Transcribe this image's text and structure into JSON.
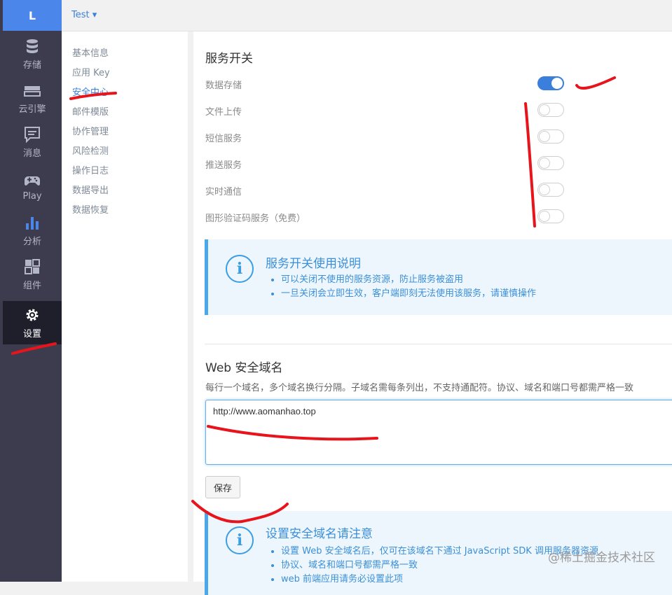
{
  "logo": "L",
  "topbar": {
    "app_name": "Test ▾"
  },
  "nav": [
    {
      "icon": "database-icon",
      "label": "存储"
    },
    {
      "icon": "cloud-engine-icon",
      "label": "云引擎"
    },
    {
      "icon": "message-icon",
      "label": "消息"
    },
    {
      "icon": "gamepad-icon",
      "label": "Play"
    },
    {
      "icon": "chart-icon",
      "label": "分析"
    },
    {
      "icon": "components-icon",
      "label": "组件"
    },
    {
      "icon": "gear-icon",
      "label": "设置",
      "active": true
    }
  ],
  "subnav": [
    "基本信息",
    "应用 Key",
    "安全中心",
    "邮件模版",
    "协作管理",
    "风险检测",
    "操作日志",
    "数据导出",
    "数据恢复"
  ],
  "subnav_active_index": 2,
  "services": {
    "title": "服务开关",
    "items": [
      {
        "label": "数据存储",
        "on": true
      },
      {
        "label": "文件上传",
        "on": false
      },
      {
        "label": "短信服务",
        "on": false
      },
      {
        "label": "推送服务",
        "on": false
      },
      {
        "label": "实时通信",
        "on": false
      },
      {
        "label": "图形验证码服务（免费）",
        "on": false
      }
    ]
  },
  "service_notice": {
    "title": "服务开关使用说明",
    "items": [
      "可以关闭不使用的服务资源，防止服务被盗用",
      "一旦关闭会立即生效，客户端即刻无法使用该服务，请谨慎操作"
    ]
  },
  "web_domain": {
    "title": "Web 安全域名",
    "hint": "每行一个域名，多个域名换行分隔。子域名需每条列出，不支持通配符。协议、域名和端口号都需严格一致",
    "value": "http://www.aomanhao.top",
    "save_label": "保存"
  },
  "domain_notice": {
    "title": "设置安全域名请注意",
    "items": [
      "设置 Web 安全域名后，仅可在该域名下通过 JavaScript SDK 调用服务器资源",
      "协议、域名和端口号都需严格一致",
      "web 前端应用请务必设置此项"
    ]
  },
  "watermark": "@稀土掘金技术社区",
  "colors": {
    "accent": "#3b7fdc",
    "nav_bg": "#3c3c4e",
    "logo_bg": "#4b86ea",
    "annotation": "#e8141c"
  }
}
